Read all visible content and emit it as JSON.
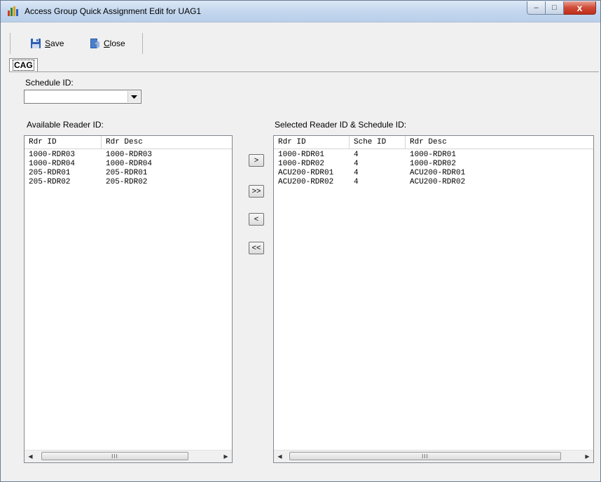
{
  "window": {
    "title": "Access Group Quick Assignment Edit for UAG1",
    "minimize_glyph": "–",
    "maximize_glyph": "□",
    "close_glyph": "x"
  },
  "toolbar": {
    "save_key": "S",
    "save_rest": "ave",
    "close_key": "C",
    "close_rest": "lose"
  },
  "tabs": [
    {
      "label": "CAG"
    }
  ],
  "schedule": {
    "label": "Schedule ID:",
    "value": ""
  },
  "available": {
    "label": "Available Reader ID:",
    "columns": [
      "Rdr ID",
      "Rdr Desc"
    ],
    "rows": [
      [
        "1000-RDR03",
        "1000-RDR03"
      ],
      [
        "1000-RDR04",
        "1000-RDR04"
      ],
      [
        "205-RDR01",
        "205-RDR01"
      ],
      [
        "205-RDR02",
        "205-RDR02"
      ]
    ]
  },
  "selected": {
    "label": "Selected Reader ID & Schedule ID:",
    "columns": [
      "Rdr ID",
      "Sche ID",
      "Rdr Desc"
    ],
    "rows": [
      [
        "1000-RDR01",
        "4",
        "1000-RDR01"
      ],
      [
        "1000-RDR02",
        "4",
        "1000-RDR02"
      ],
      [
        "ACU200-RDR01",
        "4",
        "ACU200-RDR01"
      ],
      [
        "ACU200-RDR02",
        "4",
        "ACU200-RDR02"
      ]
    ]
  },
  "move_buttons": {
    "add_one": ">",
    "add_all": ">>",
    "remove_one": "<",
    "remove_all": "<<"
  },
  "scrollbar": {
    "left_glyph": "◀",
    "right_glyph": "▶",
    "grip": "III"
  },
  "icons": {
    "app": "bar-chart-icon",
    "save": "floppy-disk-icon",
    "close": "door-exit-icon",
    "dropdown": "triangle-down-icon"
  }
}
